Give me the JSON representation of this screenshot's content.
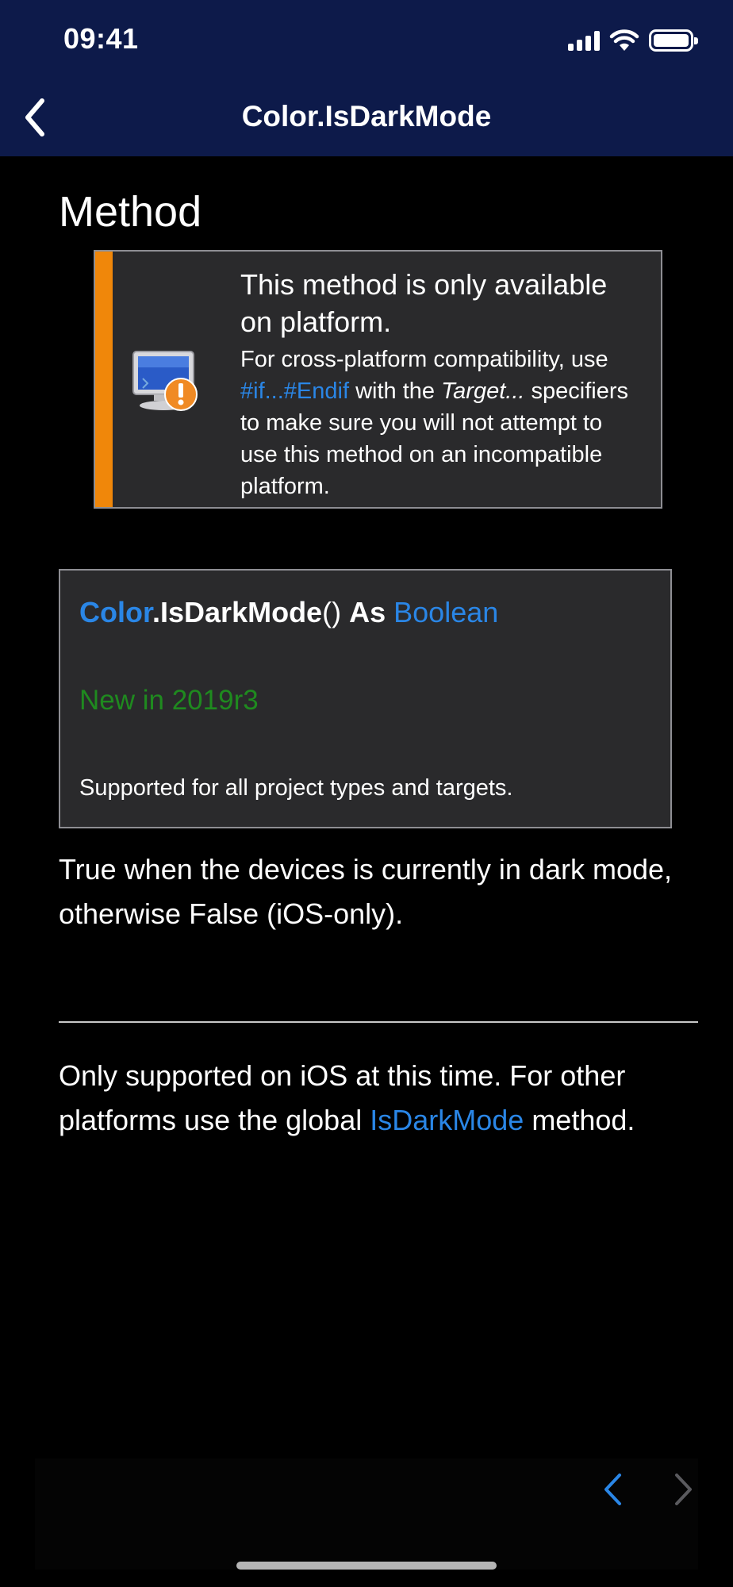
{
  "status_bar": {
    "time": "09:41"
  },
  "nav": {
    "title": "Color.IsDarkMode"
  },
  "section_title": "Method",
  "notice": {
    "headline": "This method is only available on platform.",
    "body_prefix": "For cross-platform compatibility, use",
    "link": "#if...#Endif",
    "body_mid": "with the",
    "italic": "Target...",
    "body_suffix": "specifiers to make sure you will not attempt to use this method on an incompatible platform.",
    "accent_color": "#f0870a"
  },
  "syntax": {
    "class_name": "Color",
    "method": ".IsDarkMode",
    "parens": "()",
    "as_keyword": "As",
    "return_type": "Boolean",
    "version": "New in 2019r3",
    "support": "Supported for all project types and targets."
  },
  "description": "True when the devices is currently in dark mode, otherwise False (iOS-only).",
  "note": {
    "prefix": "Only supported on iOS at this time. For other platforms use the global",
    "link": "IsDarkMode",
    "suffix": "method."
  },
  "colors": {
    "nav_background": "#0d1a4a",
    "link": "#2a86e6",
    "version_green": "#1f8a1f",
    "panel_background": "#2a2a2c"
  },
  "icons": [
    "chevron-left-icon",
    "monitor-warning-icon",
    "prev-page-icon",
    "next-page-icon"
  ]
}
